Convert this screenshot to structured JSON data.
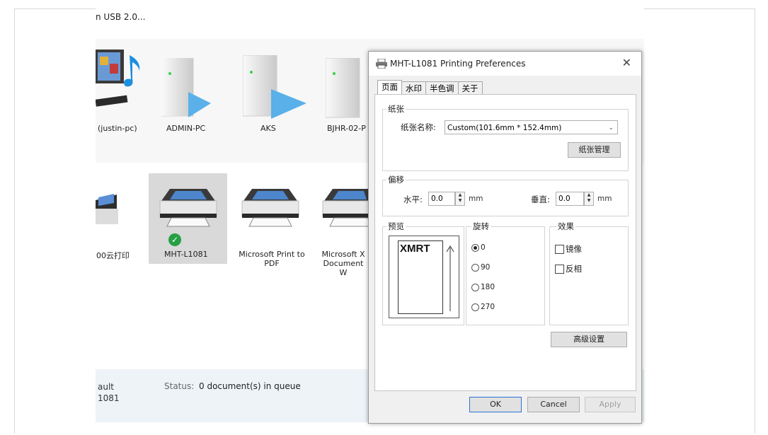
{
  "explorer": {
    "usb_text": "n USB 2.0...",
    "devices": [
      "(justin-pc)",
      "ADMIN-PC",
      "AKS",
      "BJHR-02-P"
    ],
    "printers": [
      {
        "label": "00云打印"
      },
      {
        "label": "MHT-L1081",
        "selected": true
      },
      {
        "label": "Microsoft Print to PDF"
      },
      {
        "label": "Microsoft X Document W"
      }
    ],
    "status": {
      "left1": "ault",
      "left2": "1081",
      "label": "Status:",
      "value": "0 document(s) in queue"
    }
  },
  "dialog": {
    "title": "MHT-L1081 Printing Preferences",
    "close": "✕",
    "tabs": [
      "页面",
      "水印",
      "半色调",
      "关于"
    ],
    "paper": {
      "group": "纸张",
      "name_label": "纸张名称:",
      "name_value": "Custom(101.6mm * 152.4mm)",
      "manage_button": "纸张管理"
    },
    "offset": {
      "group": "偏移",
      "h_label": "水平:",
      "h_value": "0.0",
      "v_label": "垂直:",
      "v_value": "0.0",
      "unit": "mm"
    },
    "preview": {
      "group": "预览",
      "text": "XMRT"
    },
    "rotation": {
      "group": "旋转",
      "options": [
        "0",
        "90",
        "180",
        "270"
      ],
      "selected": "0"
    },
    "effect": {
      "group": "效果",
      "mirror": "镜像",
      "invert": "反相"
    },
    "advanced_button": "高级设置",
    "ok": "OK",
    "cancel": "Cancel",
    "apply": "Apply"
  }
}
